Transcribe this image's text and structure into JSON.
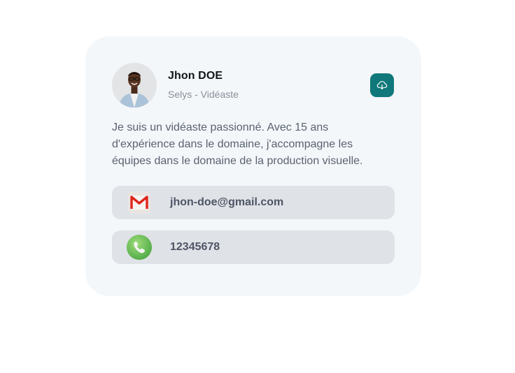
{
  "profile": {
    "name": "Jhon DOE",
    "subtitle": "Selys - Vidéaste",
    "bio": "Je suis un vidéaste passionné. Avec 15 ans d'expérience dans le domaine, j'accompagne les équipes dans le domaine de la production visuelle.",
    "avatar_icon": "person-photo"
  },
  "actions": {
    "download_icon": "cloud-download-icon"
  },
  "contacts": {
    "email": {
      "value": "jhon-doe@gmail.com",
      "icon": "gmail-icon"
    },
    "phone": {
      "value": "12345678",
      "icon": "phone-icon"
    }
  },
  "colors": {
    "card_background": "#f4f7fa",
    "accent": "#10787a",
    "contact_background": "#dfe2e6",
    "name_text": "#111418",
    "muted_text": "#8a9099",
    "body_text": "#5a6270"
  }
}
